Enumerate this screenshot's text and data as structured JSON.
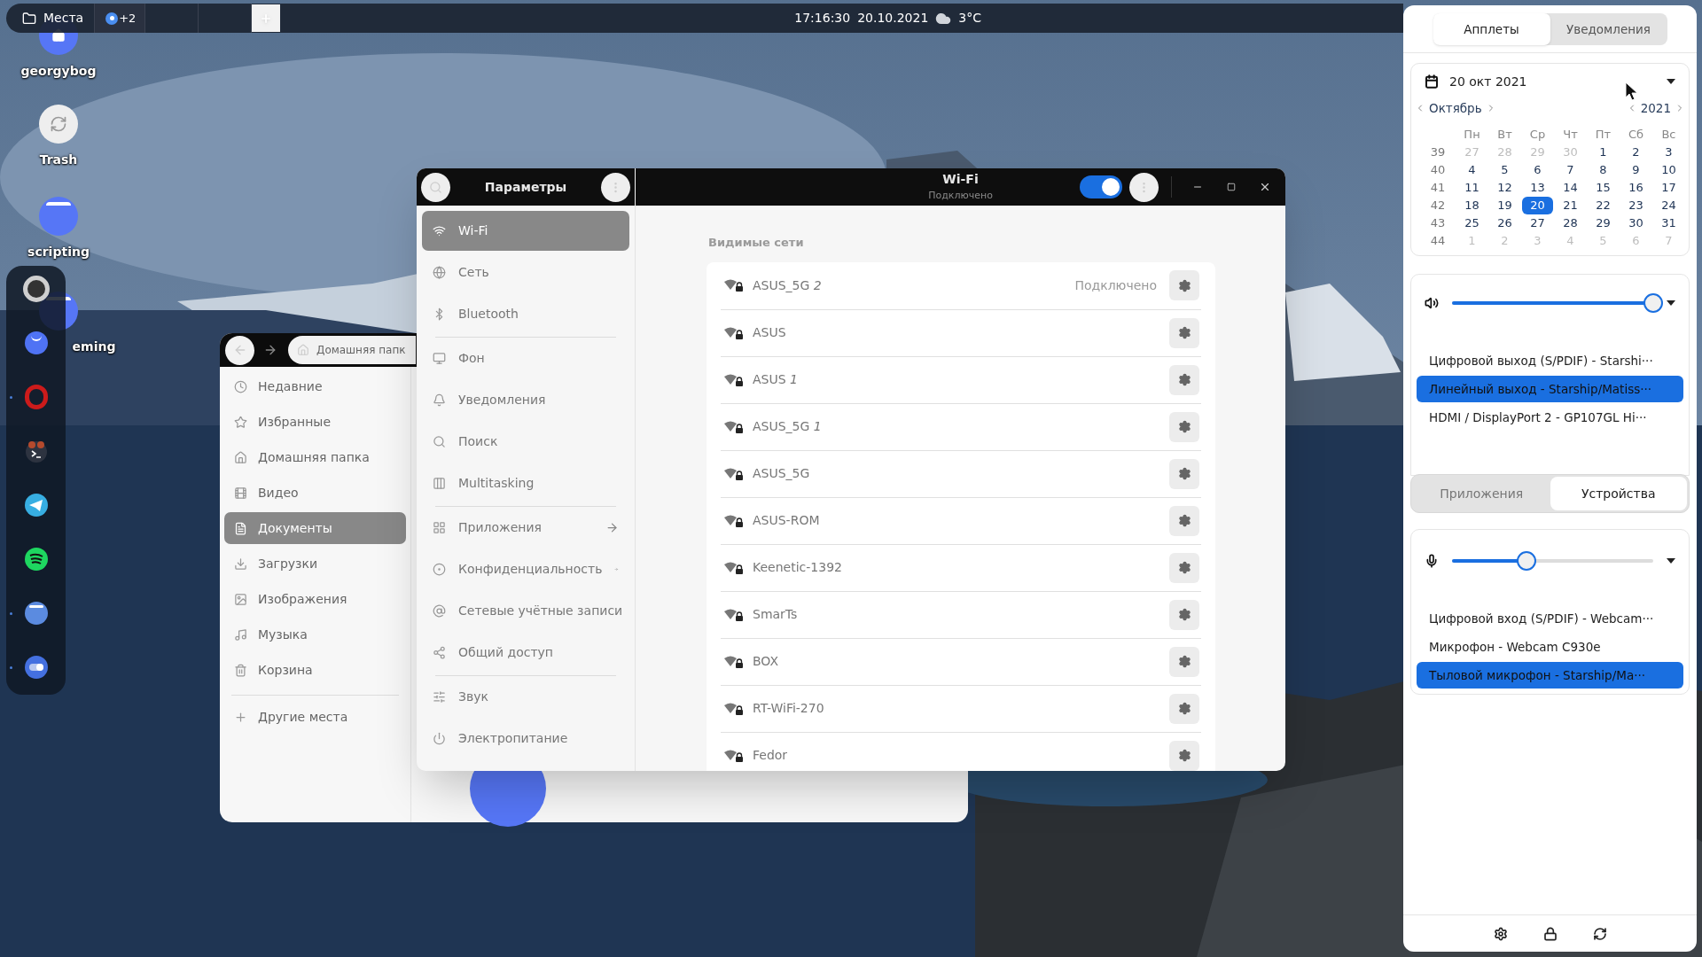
{
  "top_bar": {
    "places": "Места",
    "workspace_extra": "+2",
    "time": "17:16:30",
    "date": "20.10.2021",
    "temperature": "3°C"
  },
  "desktop_icons": [
    {
      "label": "georgybog",
      "kind": "home"
    },
    {
      "label": "Trash",
      "kind": "trash"
    },
    {
      "label": "scripting",
      "kind": "folder"
    },
    {
      "label": "eming",
      "kind": "folder"
    }
  ],
  "dock": [
    {
      "running": false
    },
    {
      "running": false
    },
    {
      "running": true
    },
    {
      "running": false
    },
    {
      "running": false
    },
    {
      "running": false
    },
    {
      "running": true
    },
    {
      "running": true
    }
  ],
  "file_manager": {
    "location": "Домашняя папк",
    "places": [
      {
        "label": "Недавние",
        "selected": false
      },
      {
        "label": "Избранные",
        "selected": false
      },
      {
        "label": "Домашняя папка",
        "selected": false
      },
      {
        "label": "Видео",
        "selected": false
      },
      {
        "label": "Документы",
        "selected": true
      },
      {
        "label": "Загрузки",
        "selected": false
      },
      {
        "label": "Изображения",
        "selected": false
      },
      {
        "label": "Музыка",
        "selected": false
      },
      {
        "label": "Корзина",
        "selected": false
      }
    ],
    "other_places": "Другие места"
  },
  "settings": {
    "title": "Параметры",
    "page_title": "Wi-Fi",
    "page_subtitle": "Подключено",
    "wifi_enabled": true,
    "sidebar_groups": [
      {
        "items": [
          {
            "label": "Wi-Fi",
            "selected": true,
            "has_arrow": false
          },
          {
            "label": "Сеть",
            "selected": false,
            "has_arrow": false
          },
          {
            "label": "Bluetooth",
            "selected": false,
            "has_arrow": false
          }
        ]
      },
      {
        "items": [
          {
            "label": "Фон",
            "selected": false,
            "has_arrow": false
          },
          {
            "label": "Уведомления",
            "selected": false,
            "has_arrow": false
          },
          {
            "label": "Поиск",
            "selected": false,
            "has_arrow": false
          },
          {
            "label": "Multitasking",
            "selected": false,
            "has_arrow": false
          }
        ]
      },
      {
        "items": [
          {
            "label": "Приложения",
            "selected": false,
            "has_arrow": true
          },
          {
            "label": "Конфиденциальность",
            "selected": false,
            "has_arrow": true
          },
          {
            "label": "Сетевые учётные записи",
            "selected": false,
            "has_arrow": false
          },
          {
            "label": "Общий доступ",
            "selected": false,
            "has_arrow": false
          }
        ]
      },
      {
        "items": [
          {
            "label": "Звук",
            "selected": false,
            "has_arrow": false
          },
          {
            "label": "Электропитание",
            "selected": false,
            "has_arrow": false
          }
        ]
      }
    ],
    "networks_heading": "Видимые сети",
    "networks": [
      {
        "name": "ASUS_5G *2*",
        "status": "Подключено"
      },
      {
        "name": "ASUS"
      },
      {
        "name": "ASUS *1*"
      },
      {
        "name": "ASUS_5G *1*"
      },
      {
        "name": "ASUS_5G"
      },
      {
        "name": "ASUS-ROM"
      },
      {
        "name": "Keenetic-1392"
      },
      {
        "name": "SmarTs"
      },
      {
        "name": "BOX"
      },
      {
        "name": "RT-WiFi-270"
      },
      {
        "name": "Fedor"
      }
    ]
  },
  "panel": {
    "tabs": [
      {
        "label": "Апплеты",
        "selected": true
      },
      {
        "label": "Уведомления",
        "selected": false
      }
    ],
    "calendar": {
      "date": "20 окт 2021",
      "month": "Октябрь",
      "year": "2021",
      "weekdays": [
        "Пн",
        "Вт",
        "Ср",
        "Чт",
        "Пт",
        "Сб",
        "Вс"
      ],
      "weeks": [
        {
          "week": "39",
          "days": [
            {
              "day": "27",
              "current_month": false,
              "selected": false
            },
            {
              "day": "28",
              "current_month": false,
              "selected": false
            },
            {
              "day": "29",
              "current_month": false,
              "selected": false
            },
            {
              "day": "30",
              "current_month": false,
              "selected": false
            },
            {
              "day": "1",
              "current_month": true,
              "selected": false
            },
            {
              "day": "2",
              "current_month": true,
              "selected": false
            },
            {
              "day": "3",
              "current_month": true,
              "selected": false
            }
          ]
        },
        {
          "week": "40",
          "days": [
            {
              "day": "4",
              "current_month": true,
              "selected": false
            },
            {
              "day": "5",
              "current_month": true,
              "selected": false
            },
            {
              "day": "6",
              "current_month": true,
              "selected": false
            },
            {
              "day": "7",
              "current_month": true,
              "selected": false
            },
            {
              "day": "8",
              "current_month": true,
              "selected": false
            },
            {
              "day": "9",
              "current_month": true,
              "selected": false
            },
            {
              "day": "10",
              "current_month": true,
              "selected": false
            }
          ]
        },
        {
          "week": "41",
          "days": [
            {
              "day": "11",
              "current_month": true,
              "selected": false
            },
            {
              "day": "12",
              "current_month": true,
              "selected": false
            },
            {
              "day": "13",
              "current_month": true,
              "selected": false
            },
            {
              "day": "14",
              "current_month": true,
              "selected": false
            },
            {
              "day": "15",
              "current_month": true,
              "selected": false
            },
            {
              "day": "16",
              "current_month": true,
              "selected": false
            },
            {
              "day": "17",
              "current_month": true,
              "selected": false
            }
          ]
        },
        {
          "week": "42",
          "days": [
            {
              "day": "18",
              "current_month": true,
              "selected": false
            },
            {
              "day": "19",
              "current_month": true,
              "selected": false
            },
            {
              "day": "20",
              "current_month": true,
              "selected": true
            },
            {
              "day": "21",
              "current_month": true,
              "selected": false
            },
            {
              "day": "22",
              "current_month": true,
              "selected": false
            },
            {
              "day": "23",
              "current_month": true,
              "selected": false
            },
            {
              "day": "24",
              "current_month": true,
              "selected": false
            }
          ]
        },
        {
          "week": "43",
          "days": [
            {
              "day": "25",
              "current_month": true,
              "selected": false
            },
            {
              "day": "26",
              "current_month": true,
              "selected": false
            },
            {
              "day": "27",
              "current_month": true,
              "selected": false
            },
            {
              "day": "28",
              "current_month": true,
              "selected": false
            },
            {
              "day": "29",
              "current_month": true,
              "selected": false
            },
            {
              "day": "30",
              "current_month": true,
              "selected": false
            },
            {
              "day": "31",
              "current_month": true,
              "selected": false
            }
          ]
        },
        {
          "week": "44",
          "days": [
            {
              "day": "1",
              "current_month": false,
              "selected": false
            },
            {
              "day": "2",
              "current_month": false,
              "selected": false
            },
            {
              "day": "3",
              "current_month": false,
              "selected": false
            },
            {
              "day": "4",
              "current_month": false,
              "selected": false
            },
            {
              "day": "5",
              "current_month": false,
              "selected": false
            },
            {
              "day": "6",
              "current_month": false,
              "selected": false
            },
            {
              "day": "7",
              "current_month": false,
              "selected": false
            }
          ]
        }
      ]
    },
    "output": {
      "level": 1,
      "devices": [
        {
          "label": "Цифровой выход (S/PDIF) - Starshi···",
          "selected": false
        },
        {
          "label": "Линейный выход - Starship/Matiss···",
          "selected": true
        },
        {
          "label": "HDMI / DisplayPort 2 - GP107GL Hi···",
          "selected": false
        }
      ]
    },
    "audio_tabs": [
      {
        "label": "Приложения",
        "selected": false
      },
      {
        "label": "Устройства",
        "selected": true
      }
    ],
    "input": {
      "level": 0.37,
      "devices": [
        {
          "label": "Цифровой вход (S/PDIF) - Webcam···",
          "selected": false
        },
        {
          "label": "Микрофон - Webcam C930e",
          "selected": false
        },
        {
          "label": "Тыловой микрофон - Starship/Ma···",
          "selected": true
        }
      ]
    }
  }
}
